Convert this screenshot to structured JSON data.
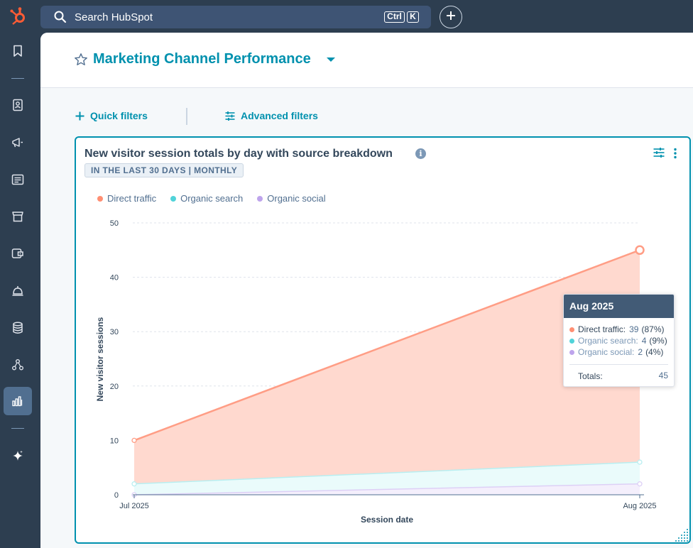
{
  "topbar": {
    "search_placeholder": "Search HubSpot",
    "shortcut_keys": [
      "Ctrl",
      "K"
    ]
  },
  "icons": {
    "logo": "hubspot-sprocket-icon",
    "search": "search-icon",
    "create": "plus-icon",
    "nav": [
      "bookmark-icon",
      "contacts-icon",
      "megaphone-icon",
      "content-icon",
      "commerce-icon",
      "service-icon",
      "automation-icon",
      "data-icon",
      "connections-icon",
      "reporting-icon",
      "ai-sparkle-icon"
    ]
  },
  "colors": {
    "accent": "#0091ae",
    "direct": "#ff8f73",
    "organic_search": "#51d3d9",
    "organic_social": "#bea4ec",
    "hubspot_orange": "#ff5c35"
  },
  "page": {
    "title": "Marketing Channel Performance"
  },
  "filters": {
    "quick": "Quick filters",
    "advanced": "Advanced filters"
  },
  "report": {
    "title": "New visitor session totals by day with source breakdown",
    "badge": "IN THE LAST 30 DAYS | MONTHLY"
  },
  "chart_data": {
    "type": "area",
    "stacked": true,
    "categories": [
      "Jul 2025",
      "Aug 2025"
    ],
    "series": [
      {
        "name": "Direct traffic",
        "values": [
          8,
          39
        ]
      },
      {
        "name": "Organic search",
        "values": [
          2,
          4
        ]
      },
      {
        "name": "Organic social",
        "values": [
          0,
          2
        ]
      }
    ],
    "yticks": [
      "0",
      "10",
      "20",
      "30",
      "40",
      "50"
    ],
    "ylim": [
      0,
      50
    ],
    "xlabel": "Session date",
    "ylabel": "New visitor sessions",
    "legend_position": "top-left",
    "grid": true
  },
  "tooltip": {
    "title": "Aug 2025",
    "rows": [
      {
        "label": "Direct traffic:",
        "value": "39",
        "pct": "(87%)"
      },
      {
        "label": "Organic search:",
        "value": "4",
        "pct": "(9%)"
      },
      {
        "label": "Organic social:",
        "value": "2",
        "pct": "(4%)"
      }
    ],
    "total_label": "Totals:",
    "total_value": "45"
  }
}
